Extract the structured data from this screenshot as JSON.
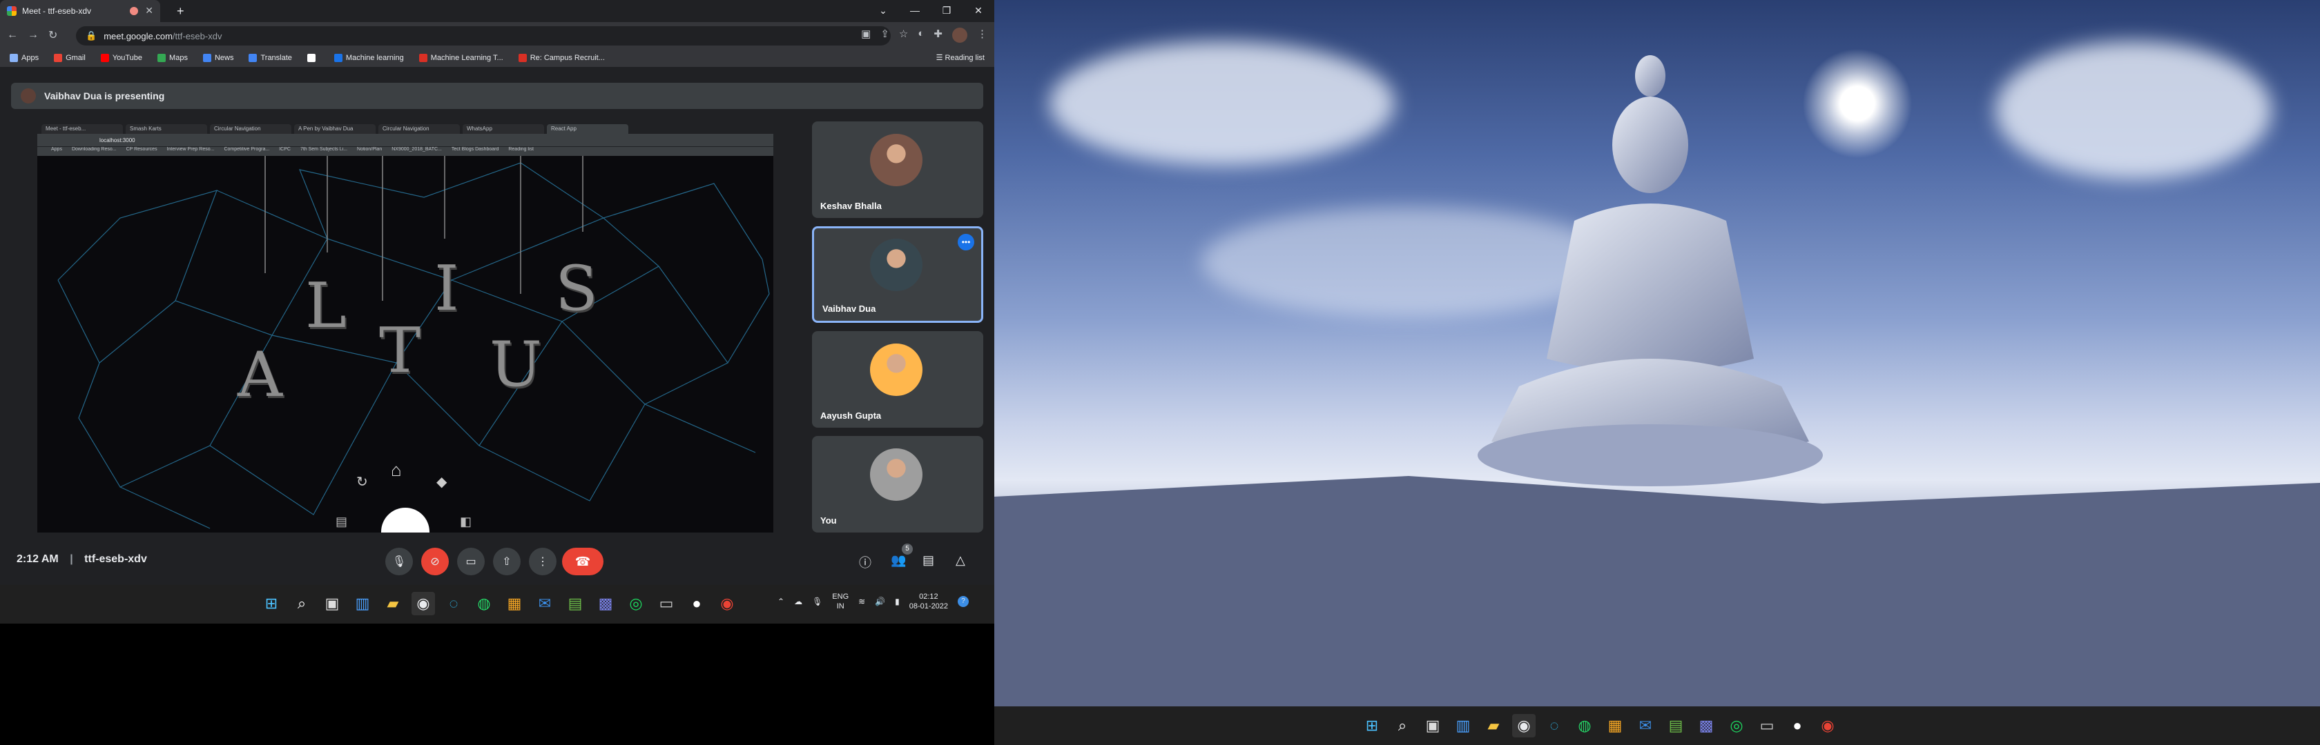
{
  "browser": {
    "tab_title": "Meet - ttf-eseb-xdv",
    "url_host": "meet.google.com",
    "url_path": "/ttf-eseb-xdv",
    "bookmarks": [
      {
        "label": "Apps",
        "color": "#8ab4f8"
      },
      {
        "label": "Gmail",
        "color": "#ea4335"
      },
      {
        "label": "YouTube",
        "color": "#ff0000"
      },
      {
        "label": "Maps",
        "color": "#34a853"
      },
      {
        "label": "News",
        "color": "#4285f4"
      },
      {
        "label": "Translate",
        "color": "#4285f4"
      },
      {
        "label": "",
        "color": "#ffffff"
      },
      {
        "label": "Machine learning",
        "color": "#1a73e8"
      },
      {
        "label": "Machine Learning T...",
        "color": "#d93025"
      },
      {
        "label": "Re: Campus Recruit...",
        "color": "#d93025"
      }
    ],
    "reading_list": "Reading list"
  },
  "meet": {
    "presenting_label": "Vaibhav Dua is presenting",
    "time": "2:12 AM",
    "separator": "|",
    "meeting_code": "ttf-eseb-xdv",
    "people_count": "5",
    "participants": [
      {
        "name": "Keshav Bhalla",
        "avatar_color": "#795548",
        "active": false
      },
      {
        "name": "Vaibhav Dua",
        "avatar_color": "#37474f",
        "active": true
      },
      {
        "name": "Aayush Gupta",
        "avatar_color": "#ffb74d",
        "active": false
      },
      {
        "name": "You",
        "avatar_color": "#9e9e9e",
        "active": false
      }
    ]
  },
  "shared_screen": {
    "tabs": [
      "Meet - ttf-eseb...",
      "Smash Karts",
      "Circular Navigation",
      "A Pen by Vaibhav Dua",
      "Circular Navigation",
      "WhatsApp",
      "React App"
    ],
    "url": "localhost:3000",
    "bookmarks": [
      "Apps",
      "Downloading Reso...",
      "CP Resources",
      "Interview Prep Reso...",
      "Competitive Progra...",
      "ICPC",
      "7th Sem Subjects Li...",
      "Notion/Plan",
      "NX9000_2018_BATC...",
      "Tect Blogs Dashboard",
      "Reading list"
    ],
    "letters": [
      "A",
      "L",
      "T",
      "I",
      "U",
      "S"
    ]
  },
  "taskbar": {
    "lang": "ENG",
    "region": "IN",
    "time": "02:12",
    "date": "08-01-2022"
  }
}
